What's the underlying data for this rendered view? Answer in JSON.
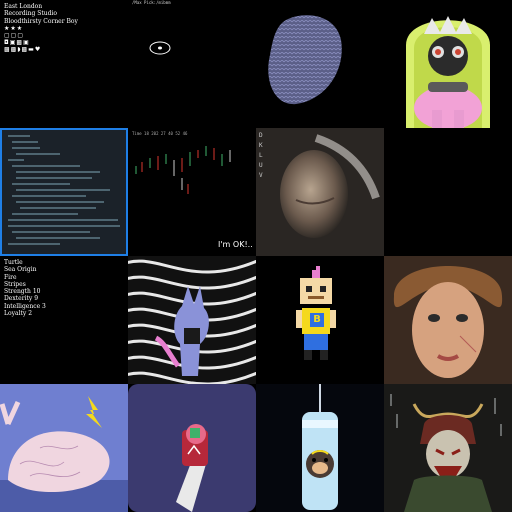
{
  "gallery": {
    "tile1": {
      "lines": [
        "East London",
        "Recording Studio",
        "Bloodthirsty Corner Boy"
      ],
      "stars": "★★★",
      "icon_row_a": "▢▢▢",
      "icon_row_b": "◘▣▩▣",
      "icon_row_c": "▩▩◗▩▬♥"
    },
    "tile2": {
      "header": "/Max Pick:/mibmm"
    },
    "tile5": {
      "header": "Time  18 202 27 40 52 46"
    },
    "tile6": {
      "letters": "D K L U V"
    },
    "tile8": {
      "caption": "I'm OK!.."
    },
    "tile9": {
      "lines": [
        "Turtle",
        "Sea Origin",
        "Fire",
        "Stripes",
        "Strength 10",
        "Dexterity 9",
        "Intelligence 3",
        "Loyalty 2"
      ]
    },
    "tile11": {
      "badge_letter": "B"
    }
  },
  "colors": {
    "selection": "#1f7fe6",
    "pink": "#e87fcf",
    "blue": "#2f6fe0",
    "yellow": "#f4d91c",
    "green": "#3fb26a",
    "red": "#d9362e"
  }
}
